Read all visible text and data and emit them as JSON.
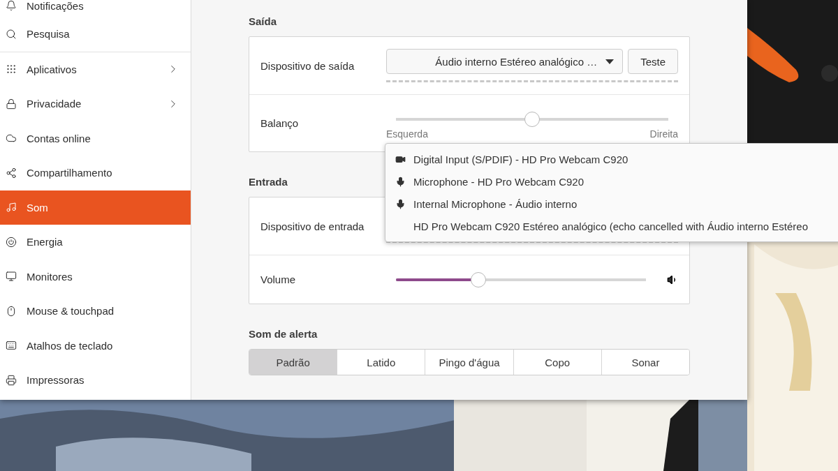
{
  "sidebar": {
    "groups": [
      [
        {
          "label": "Notificações",
          "kind": "page",
          "selected": false
        },
        {
          "label": "Pesquisa",
          "kind": "page",
          "selected": false
        }
      ],
      [
        {
          "label": "Aplicativos",
          "kind": "submenu",
          "selected": false
        },
        {
          "label": "Privacidade",
          "kind": "submenu",
          "selected": false
        },
        {
          "label": "Contas online",
          "kind": "page",
          "selected": false
        },
        {
          "label": "Compartilhamento",
          "kind": "page",
          "selected": false
        },
        {
          "label": "Som",
          "kind": "page",
          "selected": true
        },
        {
          "label": "Energia",
          "kind": "page",
          "selected": false
        },
        {
          "label": "Monitores",
          "kind": "page",
          "selected": false
        },
        {
          "label": "Mouse & touchpad",
          "kind": "page",
          "selected": false
        },
        {
          "label": "Atalhos de teclado",
          "kind": "page",
          "selected": false
        },
        {
          "label": "Impressoras",
          "kind": "page",
          "selected": false
        }
      ]
    ]
  },
  "output": {
    "heading": "Saída",
    "device": {
      "label": "Dispositivo de saída",
      "value": "Áudio interno Estéreo analógico …",
      "test_button": "Teste"
    },
    "balance": {
      "label": "Balanço",
      "level": 0.5,
      "left_label": "Esquerda",
      "right_label": "Direita"
    }
  },
  "input": {
    "heading": "Entrada",
    "device": {
      "label": "Dispositivo de entrada"
    },
    "volume": {
      "label": "Volume",
      "level": 0.33
    }
  },
  "alert": {
    "heading": "Som de alerta",
    "options": [
      {
        "label": "Padrão",
        "selected": true
      },
      {
        "label": "Latido",
        "selected": false
      },
      {
        "label": "Pingo d'água",
        "selected": false
      },
      {
        "label": "Copo",
        "selected": false
      },
      {
        "label": "Sonar",
        "selected": false
      }
    ]
  },
  "device_menu": {
    "items": [
      {
        "label": "Digital Input (S/PDIF) - HD Pro Webcam C920",
        "kind": "camera"
      },
      {
        "label": "Microphone - HD Pro Webcam C920",
        "kind": "microphone"
      },
      {
        "label": "Internal Microphone - Áudio interno",
        "kind": "microphone"
      },
      {
        "label": "HD Pro Webcam C920 Estéreo analógico (echo cancelled with Áudio interno Estéreo",
        "kind": "plain"
      }
    ]
  }
}
